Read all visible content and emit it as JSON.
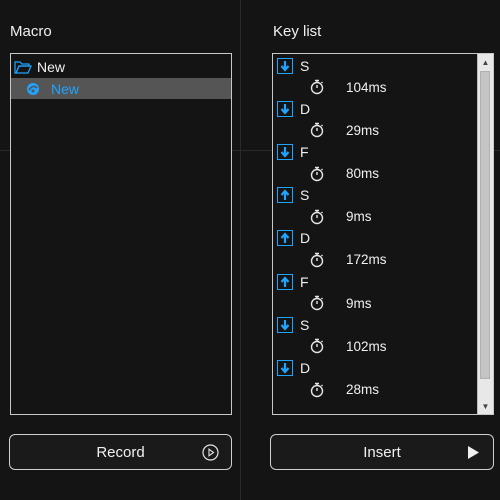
{
  "macro_panel": {
    "heading": "Macro",
    "tree": [
      {
        "label": "New",
        "icon": "folder-open-icon",
        "selected": false
      },
      {
        "label": "New",
        "icon": "macro-icon",
        "selected": true
      }
    ]
  },
  "key_panel": {
    "heading": "Key list",
    "entries": [
      {
        "direction": "down",
        "key": "S",
        "delay": "104ms"
      },
      {
        "direction": "down",
        "key": "D",
        "delay": "29ms"
      },
      {
        "direction": "down",
        "key": "F",
        "delay": "80ms"
      },
      {
        "direction": "up",
        "key": "S",
        "delay": "9ms"
      },
      {
        "direction": "up",
        "key": "D",
        "delay": "172ms"
      },
      {
        "direction": "up",
        "key": "F",
        "delay": "9ms"
      },
      {
        "direction": "down",
        "key": "S",
        "delay": "102ms"
      },
      {
        "direction": "down",
        "key": "D",
        "delay": "28ms"
      }
    ]
  },
  "buttons": {
    "record_label": "Record",
    "insert_label": "Insert"
  },
  "colors": {
    "accent": "#1fa5ff",
    "background": "#141414",
    "border": "#c8c8c8"
  }
}
